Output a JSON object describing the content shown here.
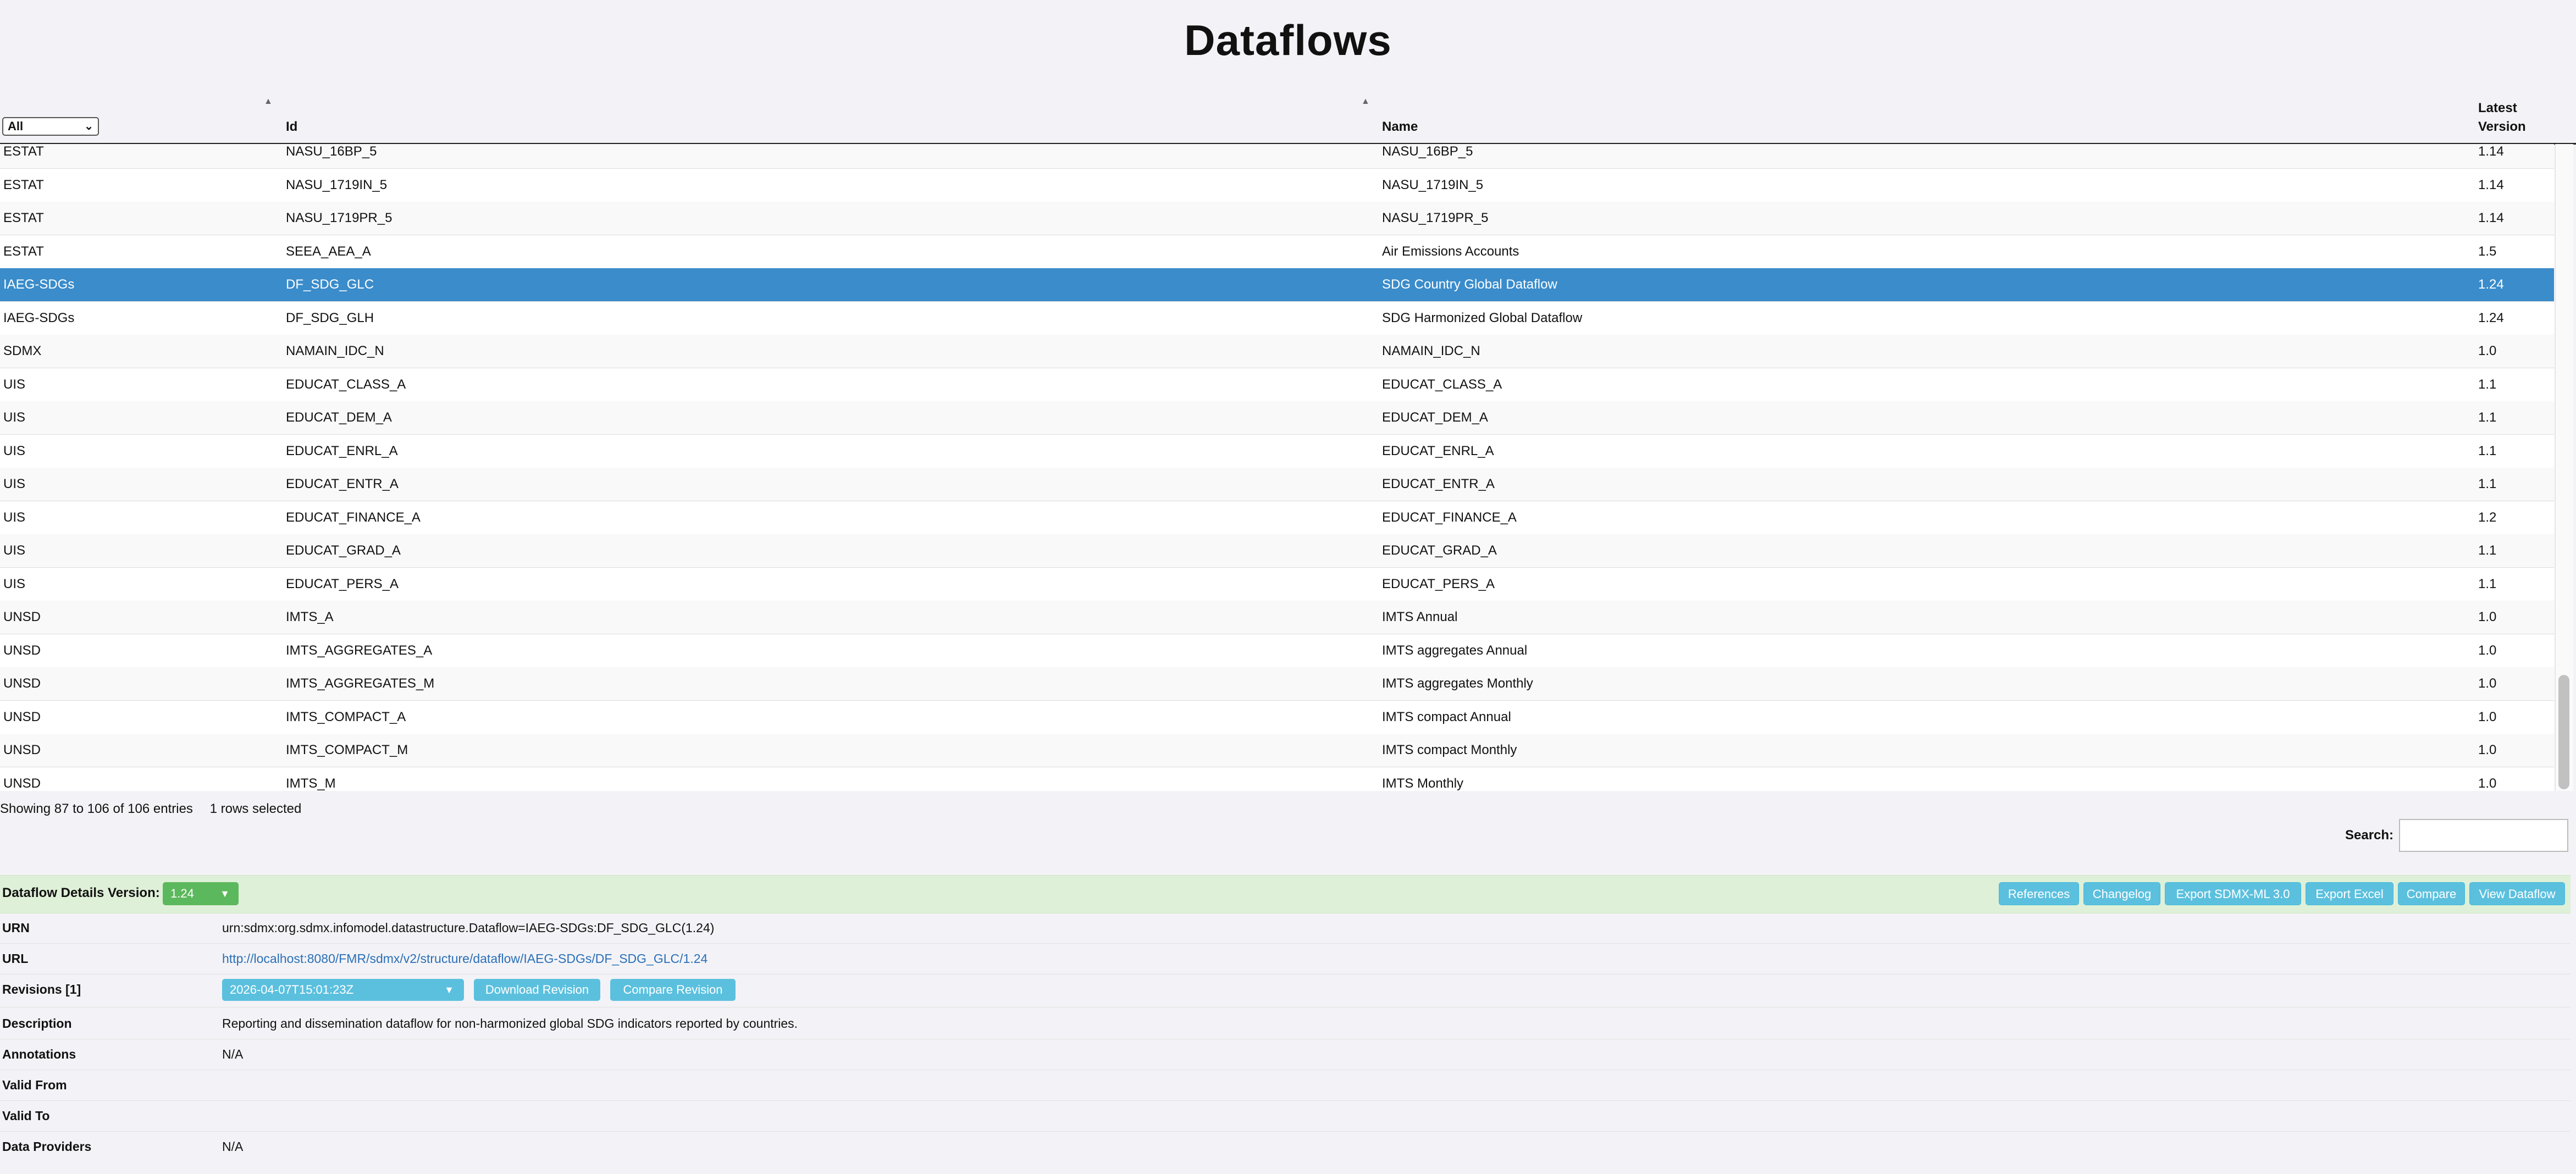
{
  "page": {
    "title": "Dataflows"
  },
  "table": {
    "filter": {
      "selected": "All"
    },
    "columns": {
      "agency": "",
      "id": "Id",
      "name": "Name",
      "version_line1": "Latest",
      "version_line2": "Version"
    },
    "rows": [
      {
        "agency": "ESTAT",
        "id": "NASU_16BP_5",
        "name": "NASU_16BP_5",
        "version": "1.14"
      },
      {
        "agency": "ESTAT",
        "id": "NASU_1719IN_5",
        "name": "NASU_1719IN_5",
        "version": "1.14"
      },
      {
        "agency": "ESTAT",
        "id": "NASU_1719PR_5",
        "name": "NASU_1719PR_5",
        "version": "1.14"
      },
      {
        "agency": "ESTAT",
        "id": "SEEA_AEA_A",
        "name": "Air Emissions Accounts",
        "version": "1.5"
      },
      {
        "agency": "IAEG-SDGs",
        "id": "DF_SDG_GLC",
        "name": "SDG Country Global Dataflow",
        "version": "1.24",
        "selected": true
      },
      {
        "agency": "IAEG-SDGs",
        "id": "DF_SDG_GLH",
        "name": "SDG Harmonized Global Dataflow",
        "version": "1.24"
      },
      {
        "agency": "SDMX",
        "id": "NAMAIN_IDC_N",
        "name": "NAMAIN_IDC_N",
        "version": "1.0"
      },
      {
        "agency": "UIS",
        "id": "EDUCAT_CLASS_A",
        "name": "EDUCAT_CLASS_A",
        "version": "1.1"
      },
      {
        "agency": "UIS",
        "id": "EDUCAT_DEM_A",
        "name": "EDUCAT_DEM_A",
        "version": "1.1"
      },
      {
        "agency": "UIS",
        "id": "EDUCAT_ENRL_A",
        "name": "EDUCAT_ENRL_A",
        "version": "1.1"
      },
      {
        "agency": "UIS",
        "id": "EDUCAT_ENTR_A",
        "name": "EDUCAT_ENTR_A",
        "version": "1.1"
      },
      {
        "agency": "UIS",
        "id": "EDUCAT_FINANCE_A",
        "name": "EDUCAT_FINANCE_A",
        "version": "1.2"
      },
      {
        "agency": "UIS",
        "id": "EDUCAT_GRAD_A",
        "name": "EDUCAT_GRAD_A",
        "version": "1.1"
      },
      {
        "agency": "UIS",
        "id": "EDUCAT_PERS_A",
        "name": "EDUCAT_PERS_A",
        "version": "1.1"
      },
      {
        "agency": "UNSD",
        "id": "IMTS_A",
        "name": "IMTS Annual",
        "version": "1.0"
      },
      {
        "agency": "UNSD",
        "id": "IMTS_AGGREGATES_A",
        "name": "IMTS aggregates Annual",
        "version": "1.0"
      },
      {
        "agency": "UNSD",
        "id": "IMTS_AGGREGATES_M",
        "name": "IMTS aggregates Monthly",
        "version": "1.0"
      },
      {
        "agency": "UNSD",
        "id": "IMTS_COMPACT_A",
        "name": "IMTS compact Annual",
        "version": "1.0"
      },
      {
        "agency": "UNSD",
        "id": "IMTS_COMPACT_M",
        "name": "IMTS compact Monthly",
        "version": "1.0"
      },
      {
        "agency": "UNSD",
        "id": "IMTS_M",
        "name": "IMTS Monthly",
        "version": "1.0"
      }
    ],
    "info": "Showing 87 to 106 of 106 entries",
    "selection_info": "1 rows selected",
    "search_label": "Search:",
    "search_value": ""
  },
  "details": {
    "title": "Dataflow Details Version:",
    "version": "1.24",
    "buttons": {
      "references": "References",
      "changelog": "Changelog",
      "export_sdmx": "Export SDMX-ML 3.0",
      "export_excel": "Export Excel",
      "compare": "Compare",
      "view_dataflow": "View Dataflow"
    },
    "fields": {
      "urn_label": "URN",
      "urn": "urn:sdmx:org.sdmx.infomodel.datastructure.Dataflow=IAEG-SDGs:DF_SDG_GLC(1.24)",
      "url_label": "URL",
      "url": "http://localhost:8080/FMR/sdmx/v2/structure/dataflow/IAEG-SDGs/DF_SDG_GLC/1.24",
      "revisions_label": "Revisions [1]",
      "revision_selected": "2026-04-07T15:01:23Z",
      "download_revision": "Download Revision",
      "compare_revision": "Compare Revision",
      "description_label": "Description",
      "description": "Reporting and dissemination dataflow for non-harmonized global SDG indicators reported by countries.",
      "annotations_label": "Annotations",
      "annotations": "N/A",
      "valid_from_label": "Valid From",
      "valid_from": "",
      "valid_to_label": "Valid To",
      "valid_to": "",
      "data_providers_label": "Data Providers",
      "data_providers": "N/A"
    }
  },
  "colors": {
    "selected_row": "#3a8ccb",
    "details_bar": "#dff0d8",
    "version_button": "#5cb85c",
    "info_button": "#5bc0de",
    "link": "#2a6fb7"
  }
}
